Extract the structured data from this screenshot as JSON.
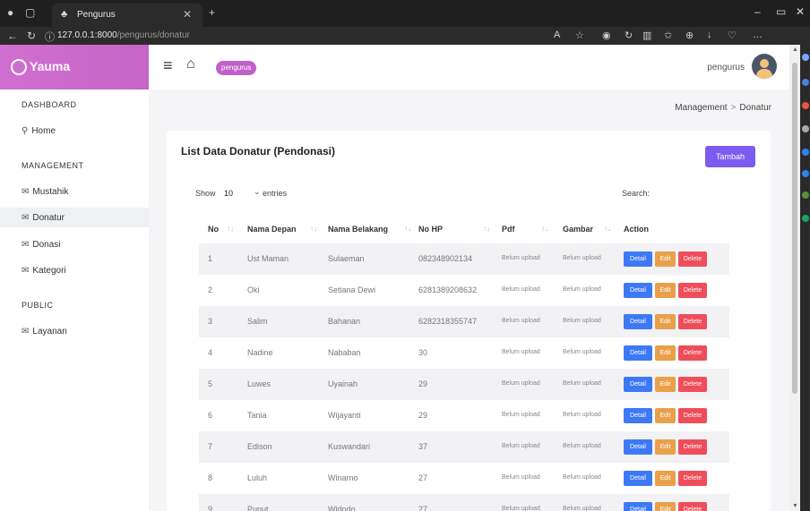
{
  "browser": {
    "tab_title": "Pengurus",
    "url_host": "127.0.0.1:8000",
    "url_path": "/pengurus/donatur",
    "reader_label": "A͡"
  },
  "sidebar": {
    "brand": "Yauma",
    "sections": [
      {
        "label": "DASHBOARD"
      },
      {
        "label": "MANAGEMENT"
      },
      {
        "label": "PUBLIC"
      }
    ],
    "items": [
      {
        "label": "Home",
        "icon": "home-icon"
      },
      {
        "label": "Mustahik",
        "icon": "mail-icon"
      },
      {
        "label": "Donatur",
        "icon": "mail-icon"
      },
      {
        "label": "Donasi",
        "icon": "mail-icon"
      },
      {
        "label": "Kategori",
        "icon": "mail-icon"
      },
      {
        "label": "Layanan",
        "icon": "mail-icon"
      }
    ]
  },
  "topbar": {
    "badge": "pengurus",
    "user": "pengurus"
  },
  "breadcrumb": {
    "parent": "Management",
    "current": "Donatur"
  },
  "card": {
    "title": "List Data Donatur (Pendonasi)",
    "add_button": "Tambah",
    "show_label": "Show",
    "show_value": "10",
    "entries_label": "entries",
    "search_label": "Search:"
  },
  "table": {
    "headers": [
      "No",
      "Nama Depan",
      "Nama Belakang",
      "No HP",
      "Pdf",
      "Gambar",
      "Action"
    ],
    "buttons": {
      "detail": "Detail",
      "edit": "Edit",
      "delete": "Delete"
    },
    "rows": [
      {
        "no": "1",
        "depan": "Ust Maman",
        "belakang": "Sulaeman",
        "hp": "082348902134",
        "pdf": "Belum upload",
        "gambar": "Belum upload"
      },
      {
        "no": "2",
        "depan": "Oki",
        "belakang": "Setiana Dewi",
        "hp": "6281389208632",
        "pdf": "Belum upload",
        "gambar": "Belum upload"
      },
      {
        "no": "3",
        "depan": "Salim",
        "belakang": "Bahanan",
        "hp": "6282318355747",
        "pdf": "Belum upload",
        "gambar": "Belum upload"
      },
      {
        "no": "4",
        "depan": "Nadine",
        "belakang": "Nababan",
        "hp": "30",
        "pdf": "Belum upload",
        "gambar": "Belum upload"
      },
      {
        "no": "5",
        "depan": "Luwes",
        "belakang": "Uyainah",
        "hp": "29",
        "pdf": "Belum upload",
        "gambar": "Belum upload"
      },
      {
        "no": "6",
        "depan": "Tania",
        "belakang": "Wijayanti",
        "hp": "29",
        "pdf": "Belum upload",
        "gambar": "Belum upload"
      },
      {
        "no": "7",
        "depan": "Edison",
        "belakang": "Kuswandari",
        "hp": "37",
        "pdf": "Belum upload",
        "gambar": "Belum upload"
      },
      {
        "no": "8",
        "depan": "Luluh",
        "belakang": "Winarno",
        "hp": "27",
        "pdf": "Belum upload",
        "gambar": "Belum upload"
      },
      {
        "no": "9",
        "depan": "Puput",
        "belakang": "Widodo",
        "hp": "27",
        "pdf": "Belum upload",
        "gambar": "Belum upload"
      }
    ]
  },
  "colors": {
    "brand_gradient": "#d16fd0",
    "badge": "#c060c8",
    "add_button": "#7b5cf0",
    "detail": "#3d79f5",
    "edit": "#e9a04a",
    "delete": "#ee4d5b"
  }
}
